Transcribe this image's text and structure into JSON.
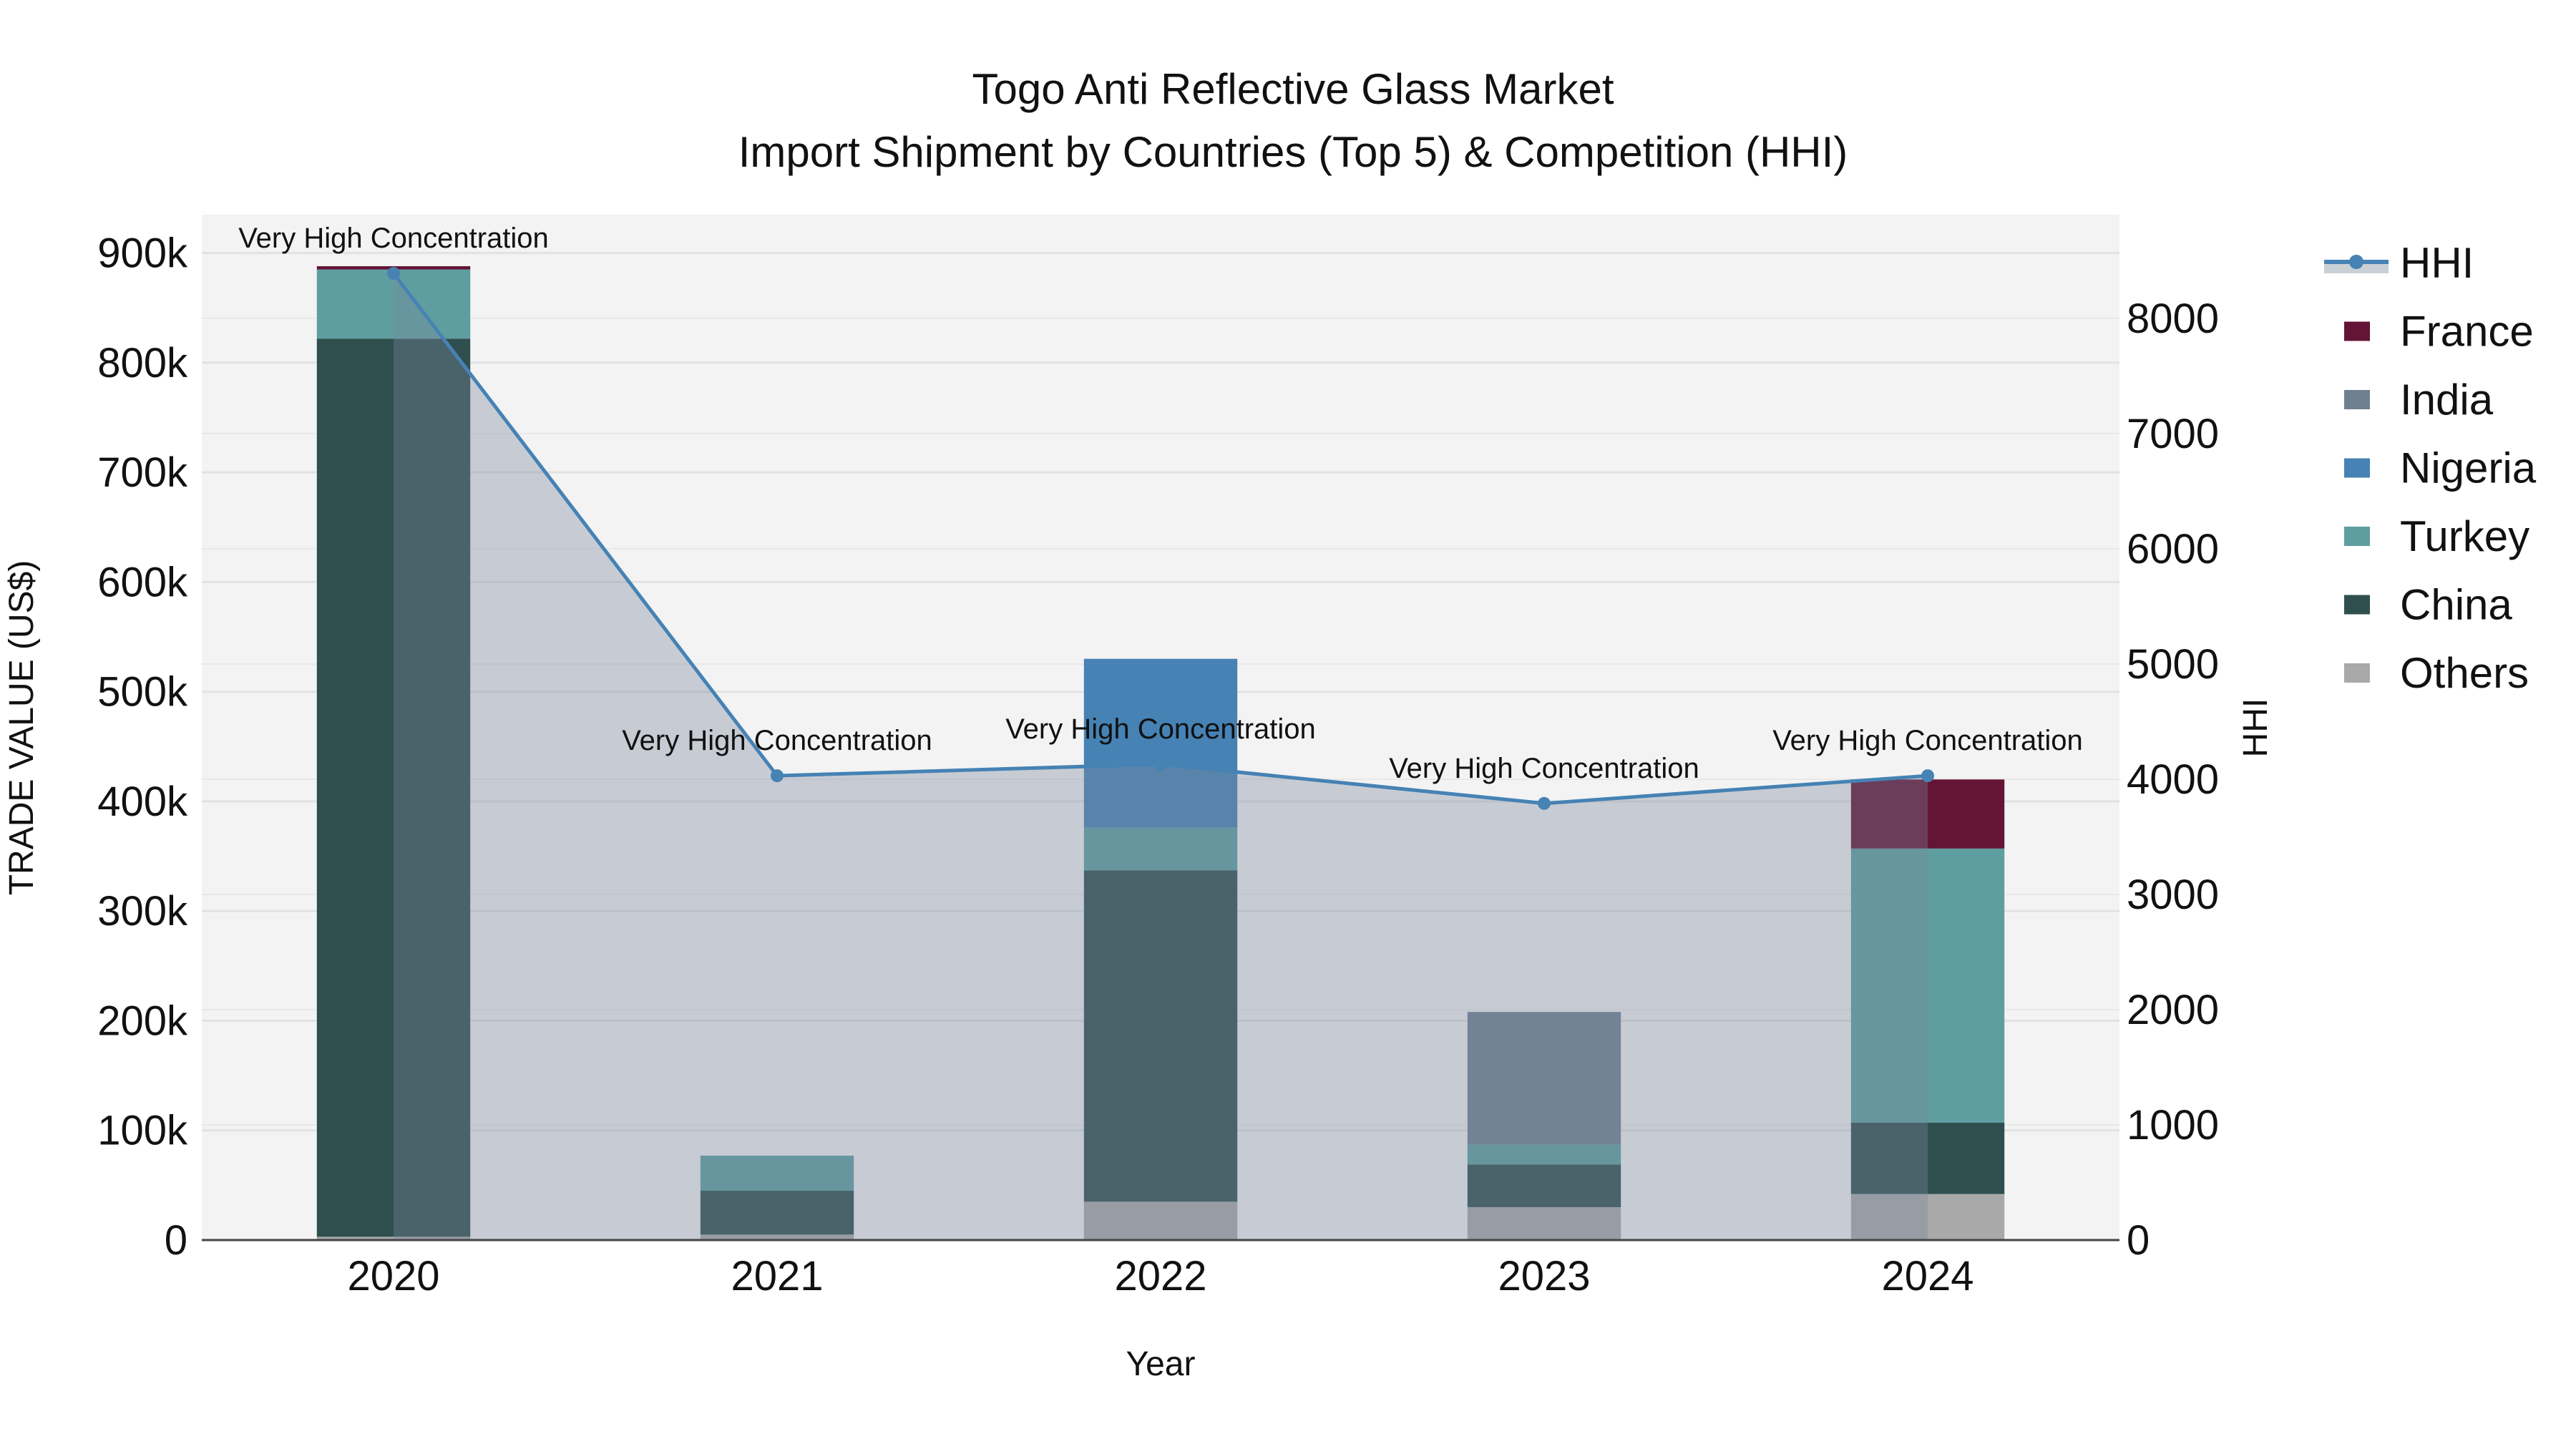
{
  "chart_data": {
    "type": "bar",
    "title": "Togo Anti Reflective Glass Market",
    "subtitle": "Import Shipment by Countries (Top 5) & Competition (HHI)",
    "xlabel": "Year",
    "ylabel": "TRADE VALUE (US$)",
    "y2label": "HHI",
    "barmode": "stack",
    "categories": [
      "2020",
      "2021",
      "2022",
      "2023",
      "2024"
    ],
    "ylim": [
      0,
      935000
    ],
    "y2lim": [
      0,
      8900
    ],
    "yticks": [
      0,
      100000,
      200000,
      300000,
      400000,
      500000,
      600000,
      700000,
      800000,
      900000
    ],
    "ytick_labels": [
      "0",
      "100k",
      "200k",
      "300k",
      "400k",
      "500k",
      "600k",
      "700k",
      "800k",
      "900k"
    ],
    "y2ticks": [
      0,
      1000,
      2000,
      3000,
      4000,
      5000,
      6000,
      7000,
      8000
    ],
    "y2tick_labels": [
      "0",
      "1000",
      "2000",
      "3000",
      "4000",
      "5000",
      "6000",
      "7000",
      "8000"
    ],
    "grid": true,
    "legend_position": "right",
    "series": [
      {
        "name": "Others",
        "color": "#A9A9A9",
        "values": [
          3000,
          5000,
          35000,
          30000,
          42000
        ]
      },
      {
        "name": "China",
        "color": "#2F4F4F",
        "values": [
          819000,
          40000,
          302000,
          39000,
          65000
        ]
      },
      {
        "name": "Turkey",
        "color": "#5F9EA0",
        "values": [
          63000,
          32000,
          39000,
          18000,
          250000
        ]
      },
      {
        "name": "Nigeria",
        "color": "#4682B4",
        "values": [
          0,
          0,
          154000,
          0,
          0
        ]
      },
      {
        "name": "India",
        "color": "#708090",
        "values": [
          0,
          0,
          0,
          121000,
          0
        ]
      },
      {
        "name": "France",
        "color": "#641436",
        "values": [
          3000,
          0,
          0,
          0,
          63000
        ]
      }
    ],
    "hhi": {
      "name": "HHI",
      "color": "#4682B4",
      "values": [
        8390,
        4030,
        4130,
        3790,
        4030
      ],
      "annotations": [
        "Very High Concentration",
        "Very High Concentration",
        "Very High Concentration",
        "Very High Concentration",
        "Very High Concentration"
      ]
    },
    "legend": [
      "HHI",
      "France",
      "India",
      "Nigeria",
      "Turkey",
      "China",
      "Others"
    ]
  }
}
